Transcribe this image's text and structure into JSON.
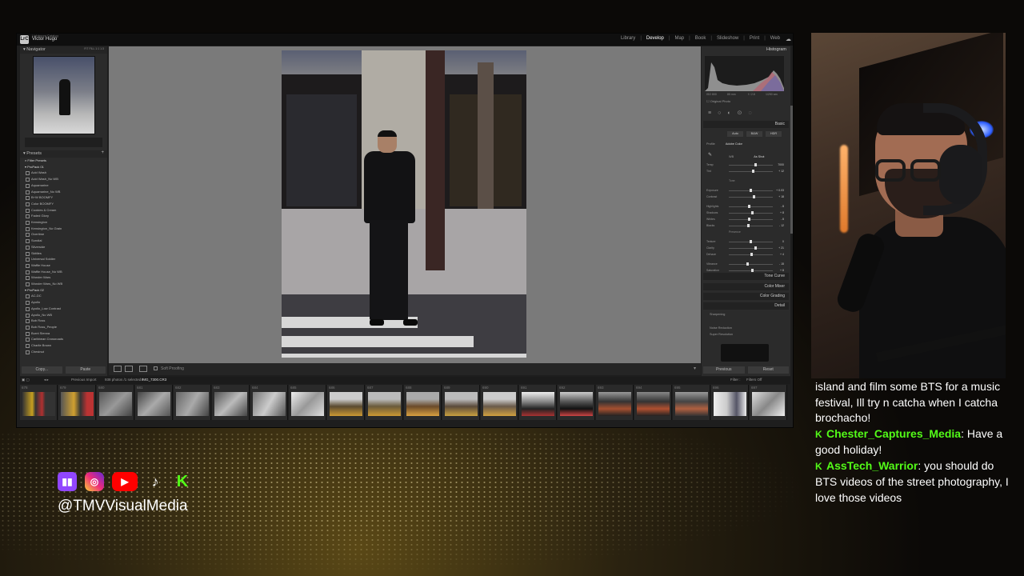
{
  "lightroom": {
    "catalog": "Lightroom Catalog",
    "user": "Victor Hugo",
    "modules": [
      "Library",
      "Develop",
      "Map",
      "Book",
      "Slideshow",
      "Print",
      "Web"
    ],
    "active_module": "Develop",
    "left": {
      "navigator_title": "Navigator",
      "navigator_zoom": "FIT  FILL  1:1  1:3",
      "presets_title": "Presets",
      "filter_label": "Filter Presets",
      "groups": [
        {
          "name": "ProPack 01",
          "items": [
            "Acid Wash",
            "Acid Wash_No WB",
            "Aquamarine",
            "Aquamarine_No WB",
            "B+W BOOMFY",
            "Color BOOMFY",
            "Cookies & Cream",
            "Faded Glory",
            "Kensington",
            "Kensington_No Grain",
            "Overtime",
            "Sundial",
            "Silverside",
            "Skittles",
            "Universal Soldier",
            "Waffle House",
            "Waffle House_No WB",
            "Wonder Wars",
            "Wonder Wars_No WB"
          ]
        },
        {
          "name": "ProPack 02",
          "items": [
            "AC-DC",
            "Apollo",
            "Apollo_Low Contrast",
            "Apollo_No WB",
            "Bob Ross",
            "Bob Ross_People",
            "Burnt Sienna",
            "Caribbean Crossroads",
            "Charlie Brown",
            "Chestnut"
          ]
        }
      ],
      "copy_label": "Copy...",
      "paste_label": "Paste"
    },
    "toolbar": {
      "soft_proofing": "Soft Proofing"
    },
    "right": {
      "histogram_title": "Histogram",
      "hist_info": [
        "ISO 800",
        "85 mm",
        "f / 2.8",
        "1/250 sec"
      ],
      "original_photo": "Original Photo",
      "basic_title": "Basic",
      "auto_buttons": [
        "Auto",
        "B&W",
        "HDR"
      ],
      "profile_label": "Profile",
      "profile_value": "Adobe Color",
      "wb_label": "WB",
      "wb_value": "As Shot",
      "sliders": [
        {
          "label": "Temp",
          "value": "7000",
          "pos": 0.6
        },
        {
          "label": "Tint",
          "value": "+ 12",
          "pos": 0.55
        },
        {
          "label": "Exposure",
          "value": "+ 0.03",
          "pos": 0.5
        },
        {
          "label": "Contrast",
          "value": "+ 18",
          "pos": 0.58
        },
        {
          "label": "Highlights",
          "value": "- 8",
          "pos": 0.46
        },
        {
          "label": "Shadows",
          "value": "+ 8",
          "pos": 0.54
        },
        {
          "label": "Whites",
          "value": "- 8",
          "pos": 0.46
        },
        {
          "label": "Blacks",
          "value": "- 12",
          "pos": 0.44
        },
        {
          "label": "Texture",
          "value": "0",
          "pos": 0.5
        },
        {
          "label": "Clarity",
          "value": "+ 21",
          "pos": 0.6
        },
        {
          "label": "Dehaze",
          "value": "+ 4",
          "pos": 0.52
        },
        {
          "label": "Vibrance",
          "value": "- 15",
          "pos": 0.42
        },
        {
          "label": "Saturation",
          "value": "+ 8",
          "pos": 0.54
        }
      ],
      "tone_section": "Tone",
      "presence_section": "Presence",
      "tone_curve": "Tone Curve",
      "color_mixer": "Color Mixer",
      "color_grading": "Color Grading",
      "detail": "Detail",
      "sharpening": "Sharpening",
      "noise_reduction": "Noise Reduction",
      "super_resolution": "Super Resolution",
      "previous_label": "Previous",
      "reset_label": "Reset"
    },
    "filmstrip": {
      "source": "Previous Import",
      "count": "938 photos /1 selected /",
      "filename": "IMG_7300.CR3",
      "filter_label": "Filter :",
      "filter_value": "Filters Off",
      "numbers": [
        "678",
        "679",
        "680",
        "681",
        "682",
        "683",
        "684",
        "685",
        "686",
        "687",
        "688",
        "689",
        "690",
        "691",
        "692",
        "693",
        "694",
        "695",
        "696",
        "697"
      ]
    }
  },
  "chat": {
    "messages": [
      {
        "user": "",
        "text": "island and film some BTS for a music festival, Ill try n catcha when I catcha brochacho!"
      },
      {
        "user": "Chester_Captures_Media",
        "text": ": Have a good holiday!"
      },
      {
        "user": "AssTech_Warrior",
        "text": ": you should do BTS videos of the street photography, I love those videos"
      }
    ]
  },
  "overlay": {
    "handle": "@TMVVisualMedia",
    "icons": [
      "twitch-icon",
      "instagram-icon",
      "youtube-icon",
      "tiktok-icon",
      "kick-icon"
    ]
  },
  "colors": {
    "kick_green": "#53fc18",
    "twitch_purple": "#9146ff",
    "youtube_red": "#ff0000"
  }
}
